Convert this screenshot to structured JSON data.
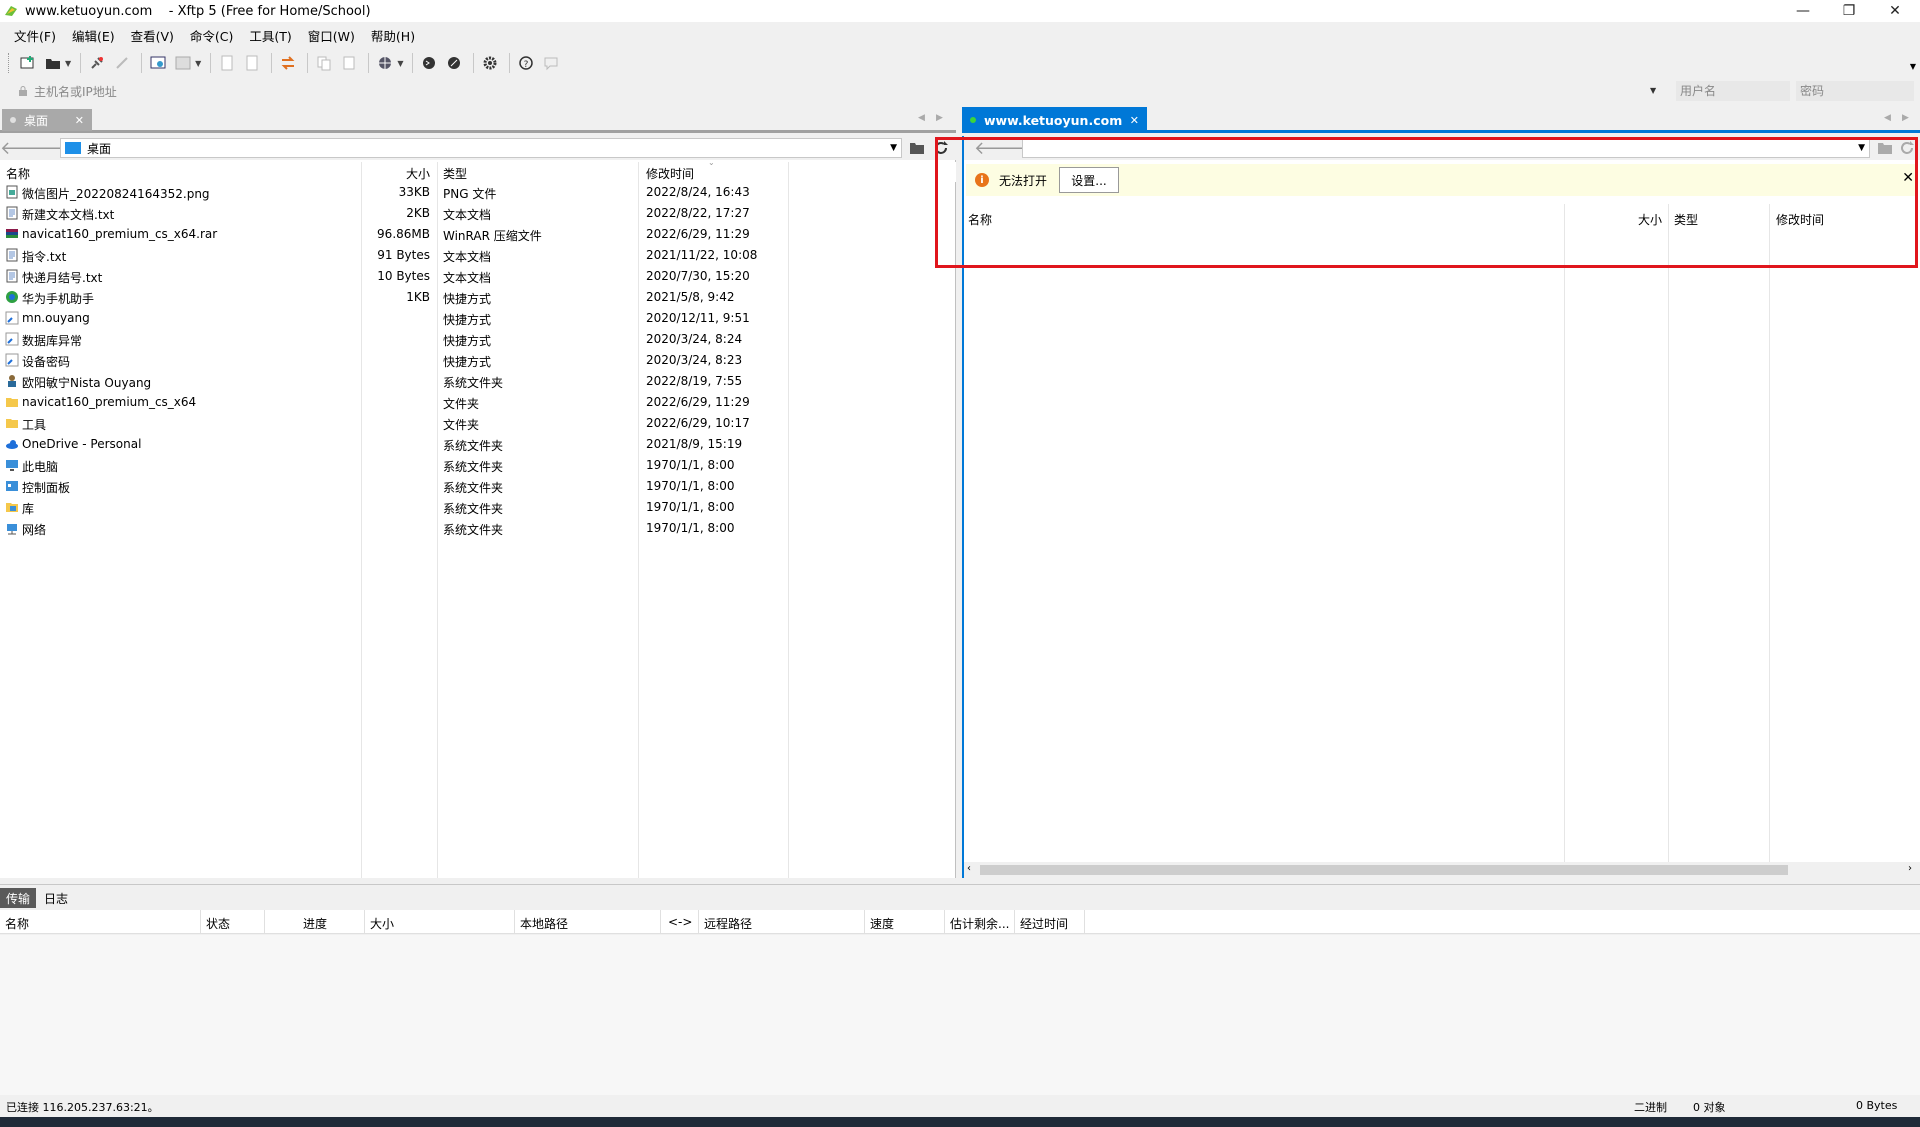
{
  "window": {
    "title": "www.ketuoyun.com    - Xftp 5 (Free for Home/School)",
    "minimize": "—",
    "restore": "❐",
    "close": "✕"
  },
  "menu": [
    "文件(F)",
    "编辑(E)",
    "查看(V)",
    "命令(C)",
    "工具(T)",
    "窗口(W)",
    "帮助(H)"
  ],
  "address": {
    "host_placeholder": "主机名或IP地址",
    "user_placeholder": "用户名",
    "password_placeholder": "密码"
  },
  "local": {
    "tab_label": "桌面",
    "path": "桌面",
    "columns": {
      "name": "名称",
      "size": "大小",
      "type": "类型",
      "mtime": "修改时间"
    },
    "files": [
      {
        "name": "微信图片_20220824164352.png",
        "size": "33KB",
        "type": "PNG 文件",
        "mtime": "2022/8/24, 16:43",
        "icon": "image-file-icon"
      },
      {
        "name": "新建文本文档.txt",
        "size": "2KB",
        "type": "文本文档",
        "mtime": "2022/8/22, 17:27",
        "icon": "text-file-icon"
      },
      {
        "name": "navicat160_premium_cs_x64.rar",
        "size": "96.86MB",
        "type": "WinRAR 压缩文件",
        "mtime": "2022/6/29, 11:29",
        "icon": "rar-archive-icon"
      },
      {
        "name": "指令.txt",
        "size": "91 Bytes",
        "type": "文本文档",
        "mtime": "2021/11/22, 10:08",
        "icon": "text-file-icon"
      },
      {
        "name": "快递月结号.txt",
        "size": "10 Bytes",
        "type": "文本文档",
        "mtime": "2020/7/30, 15:20",
        "icon": "text-file-icon"
      },
      {
        "name": "华为手机助手",
        "size": "1KB",
        "type": "快捷方式",
        "mtime": "2021/5/8, 9:42",
        "icon": "huawei-shortcut-icon"
      },
      {
        "name": "mn.ouyang",
        "size": "",
        "type": "快捷方式",
        "mtime": "2020/12/11, 9:51",
        "icon": "folder-shortcut-icon"
      },
      {
        "name": "数据库异常",
        "size": "",
        "type": "快捷方式",
        "mtime": "2020/3/24, 8:24",
        "icon": "folder-shortcut-icon"
      },
      {
        "name": "设备密码",
        "size": "",
        "type": "快捷方式",
        "mtime": "2020/3/24, 8:23",
        "icon": "folder-shortcut-icon"
      },
      {
        "name": "欧阳敏宁Nista Ouyang",
        "size": "",
        "type": "系统文件夹",
        "mtime": "2022/8/19, 7:55",
        "icon": "user-folder-icon"
      },
      {
        "name": "navicat160_premium_cs_x64",
        "size": "",
        "type": "文件夹",
        "mtime": "2022/6/29, 11:29",
        "icon": "folder-icon"
      },
      {
        "name": "工具",
        "size": "",
        "type": "文件夹",
        "mtime": "2022/6/29, 10:17",
        "icon": "folder-icon"
      },
      {
        "name": "OneDrive - Personal",
        "size": "",
        "type": "系统文件夹",
        "mtime": "2021/8/9, 15:19",
        "icon": "onedrive-icon"
      },
      {
        "name": "此电脑",
        "size": "",
        "type": "系统文件夹",
        "mtime": "1970/1/1, 8:00",
        "icon": "computer-icon"
      },
      {
        "name": "控制面板",
        "size": "",
        "type": "系统文件夹",
        "mtime": "1970/1/1, 8:00",
        "icon": "control-panel-icon"
      },
      {
        "name": "库",
        "size": "",
        "type": "系统文件夹",
        "mtime": "1970/1/1, 8:00",
        "icon": "library-icon"
      },
      {
        "name": "网络",
        "size": "",
        "type": "系统文件夹",
        "mtime": "1970/1/1, 8:00",
        "icon": "network-icon"
      }
    ]
  },
  "remote": {
    "tab_label": "www.ketuoyun.com",
    "error_text": "无法打开",
    "settings_button": "设置...",
    "columns": {
      "name": "名称",
      "size": "大小",
      "type": "类型",
      "mtime": "修改时间"
    }
  },
  "bottom": {
    "tabs": [
      "传输",
      "日志"
    ],
    "columns": [
      "名称",
      "状态",
      "进度",
      "大小",
      "本地路径",
      "<->",
      "远程路径",
      "速度",
      "估计剩余...",
      "经过时间"
    ]
  },
  "status": {
    "connection": "已连接 116.205.237.63:21。",
    "mode": "二进制",
    "objects": "0 对象",
    "bytes": "0 Bytes"
  },
  "colors": {
    "accent": "#0078d7",
    "highlight_box": "#e0161d",
    "info_bg": "#fdfde2"
  }
}
